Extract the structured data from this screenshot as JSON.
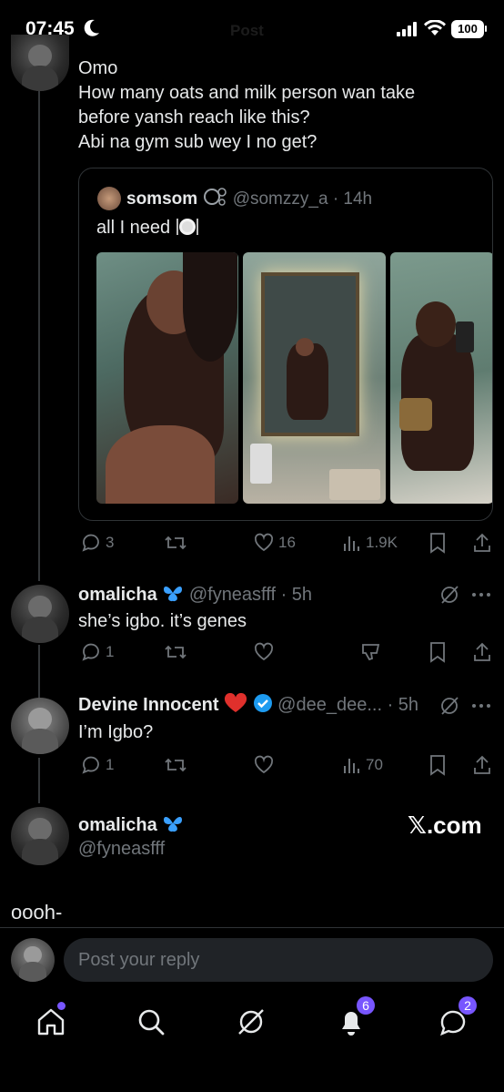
{
  "status_bar": {
    "time": "07:45",
    "battery": "100"
  },
  "header": {
    "title": "Post"
  },
  "main_post": {
    "lines": [
      "Omo",
      "How many oats and milk person wan take",
      "before yansh reach like this?",
      "Abi na gym sub wey I no get?"
    ],
    "quote": {
      "name": "somsom",
      "handle": "@somzzy_a",
      "time": "· 14h",
      "text": "all I need"
    },
    "stats": {
      "replies": "3",
      "likes": "16",
      "views": "1.9K"
    }
  },
  "reply1": {
    "name": "omalicha",
    "handle": "@fyneasfff",
    "time": "· 5h",
    "text": "she’s igbo. it’s genes",
    "replies": "1"
  },
  "reply2": {
    "name": "Devine Innocent",
    "handle": "@dee_dee...",
    "time": "· 5h",
    "text": "I’m Igbo?",
    "replies": "1",
    "views": "70"
  },
  "reply3": {
    "name": "omalicha",
    "handle": "@fyneasfff",
    "text": "oooh-"
  },
  "watermark": "𝕏.com",
  "reply_box": {
    "placeholder": "Post your reply"
  },
  "tabbar": {
    "notifications_badge": "6",
    "messages_badge": "2"
  },
  "colors": {
    "accent": "#7856ff",
    "verified": "#1d9bf0",
    "muted": "#71767b"
  }
}
